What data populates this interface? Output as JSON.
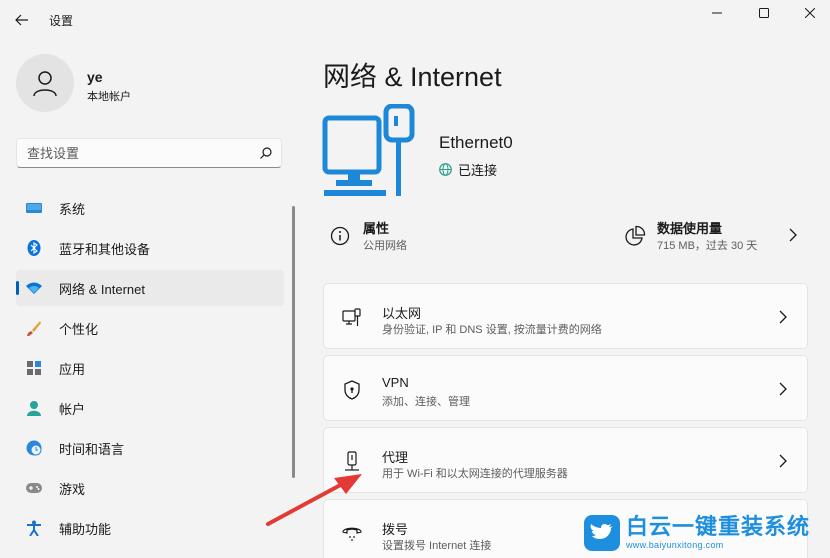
{
  "app": {
    "title": "设置"
  },
  "user": {
    "name": "ye",
    "account_type": "本地帐户"
  },
  "search": {
    "placeholder": "查找设置"
  },
  "nav": {
    "items": [
      {
        "label": "系统",
        "icon": "monitor-icon"
      },
      {
        "label": "蓝牙和其他设备",
        "icon": "bluetooth-icon"
      },
      {
        "label": "网络 & Internet",
        "icon": "wifi-icon",
        "active": true
      },
      {
        "label": "个性化",
        "icon": "brush-icon"
      },
      {
        "label": "应用",
        "icon": "apps-icon"
      },
      {
        "label": "帐户",
        "icon": "person-icon"
      },
      {
        "label": "时间和语言",
        "icon": "globe-clock-icon"
      },
      {
        "label": "游戏",
        "icon": "gamepad-icon"
      },
      {
        "label": "辅助功能",
        "icon": "accessibility-icon"
      }
    ]
  },
  "page": {
    "title": "网络 & Internet",
    "adapter": {
      "name": "Ethernet0",
      "status": "已连接"
    },
    "properties": {
      "title": "属性",
      "subtitle": "公用网络"
    },
    "data_usage": {
      "title": "数据使用量",
      "subtitle": "715 MB，过去 30 天"
    },
    "cards": [
      {
        "title": "以太网",
        "subtitle": "身份验证, IP 和 DNS 设置, 按流量计费的网络",
        "icon": "ethernet-icon"
      },
      {
        "title": "VPN",
        "subtitle": "添加、连接、管理",
        "icon": "shield-icon"
      },
      {
        "title": "代理",
        "subtitle": "用于 Wi-Fi 和以太网连接的代理服务器",
        "icon": "proxy-icon"
      },
      {
        "title": "拨号",
        "subtitle": "设置拨号 Internet 连接",
        "icon": "dialup-icon"
      }
    ]
  },
  "watermark": {
    "text": "白云一键重装系统",
    "url": "www.baiyunxitong.com"
  },
  "colors": {
    "accent": "#005fb8",
    "adapter_blue": "#1e88d8",
    "watermark_blue": "#1e8fde",
    "arrow_red": "#e53935"
  }
}
